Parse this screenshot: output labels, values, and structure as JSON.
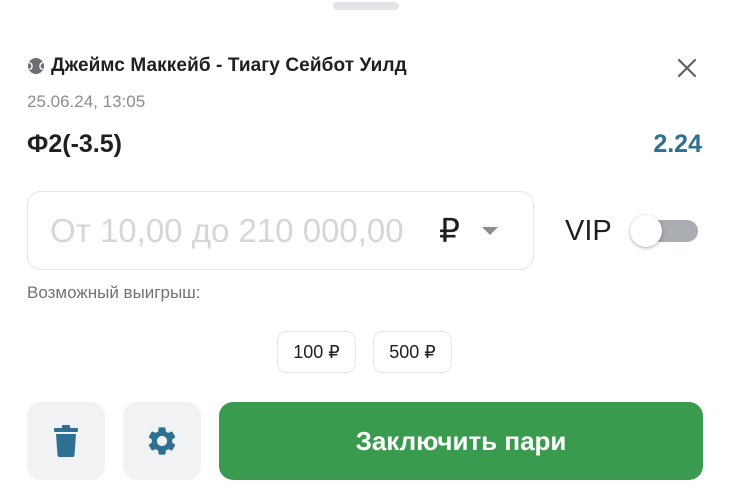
{
  "match": {
    "title": "Джеймс Маккейб - Тиагу Сейбот Уилд",
    "sport_icon": "tennis-ball-icon",
    "date": "25.06.24,  13:05"
  },
  "bet": {
    "name": "Ф2(-3.5)",
    "odds": "2.24"
  },
  "stake": {
    "placeholder": "От 10,00 до 210 000,00",
    "value": "",
    "currency": "₽"
  },
  "vip": {
    "label": "VIP",
    "enabled": false
  },
  "possible_win": {
    "label": "Возможный выигрыш:"
  },
  "quick_amounts": [
    "100 ₽",
    "500 ₽"
  ],
  "actions": {
    "submit_label": "Заключить пари",
    "delete_icon": "trash-icon",
    "settings_icon": "gear-icon"
  },
  "colors": {
    "odds": "#2f6f91",
    "submit": "#3a9b4f",
    "icon_accent": "#2f6f91"
  }
}
